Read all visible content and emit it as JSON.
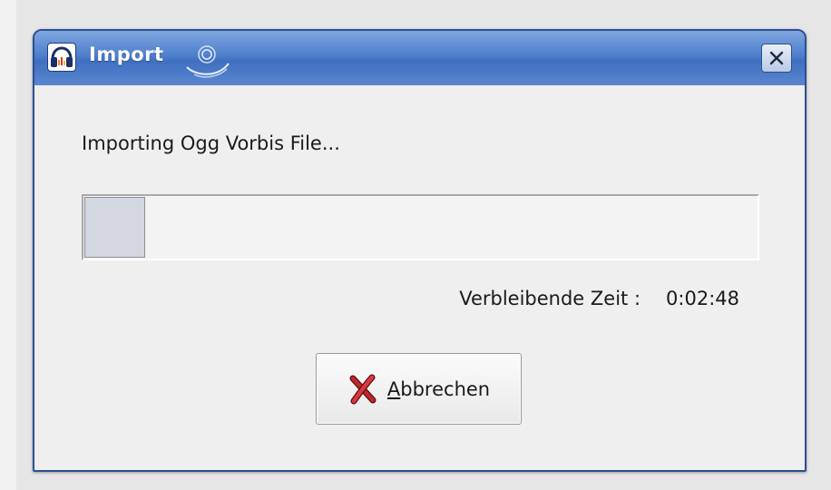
{
  "window": {
    "title": "Import",
    "icon": "audacity-headphones-icon",
    "logo": "swirl-logo-icon",
    "close_icon": "close-icon"
  },
  "dialog": {
    "message": "Importing Ogg Vorbis File...",
    "progress": {
      "fraction": 0.09
    },
    "remaining_label": "Verbleibende Zeit :",
    "remaining_value": "0:02:48",
    "cancel_button": {
      "icon": "cancel-x-icon",
      "mnemonic": "A",
      "label_rest": "bbrechen"
    }
  },
  "colors": {
    "titlebar": "#4f7fcc",
    "window_border": "#2b4f93",
    "background": "#efefef",
    "progress_fill": "#d3d7df",
    "cancel_icon": "#c0272d"
  }
}
